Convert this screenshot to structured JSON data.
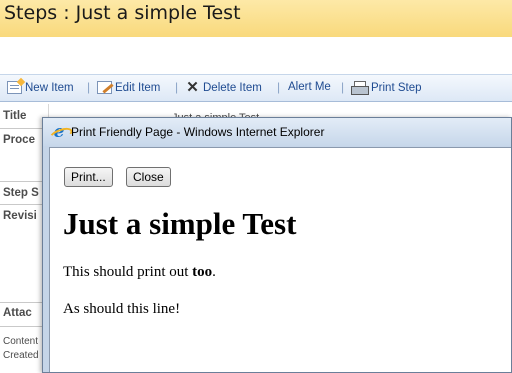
{
  "page": {
    "title": "Steps : Just a simple Test",
    "toolbar": {
      "new_item": "New Item",
      "edit_item": "Edit Item",
      "delete_item": "Delete Item",
      "alert_me": "Alert Me",
      "print_step": "Print Step",
      "separator": "|"
    },
    "fields": {
      "title": "Title",
      "procedure": "Proce",
      "step_s": "Step S",
      "revision": "Revisi",
      "attachments": "Attac"
    },
    "meta": {
      "content": "Content",
      "created": "Created"
    },
    "title_value_peek": "Just a simple Test"
  },
  "popup": {
    "window_title": "Print Friendly Page - Windows Internet Explorer",
    "print_button": "Print...",
    "close_button": "Close",
    "heading": "Just a simple Test",
    "line1_prefix": "This should print out ",
    "line1_bold": "too",
    "line1_suffix": ".",
    "line2": "As should this line!"
  },
  "colors": {
    "banner": "#fbe08f",
    "toolbar_link": "#1f4b91",
    "ie_frame": "#c5d5e8"
  },
  "icons": [
    "new-item-icon",
    "edit-item-icon",
    "delete-x-icon",
    "printer-icon",
    "ie-logo-icon"
  ]
}
